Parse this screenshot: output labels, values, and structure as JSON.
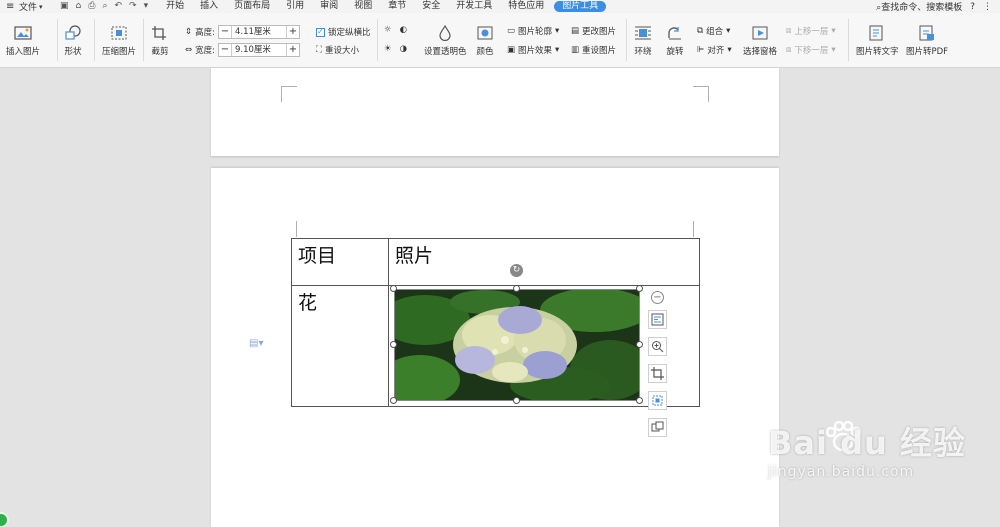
{
  "menubar": {
    "file_label": "文件",
    "tabs": [
      "开始",
      "插入",
      "页面布局",
      "引用",
      "审阅",
      "视图",
      "章节",
      "安全",
      "开发工具",
      "特色应用",
      "图片工具"
    ],
    "active_tab": "图片工具",
    "search_label": "查找命令、搜索模板",
    "help_label": "?"
  },
  "ribbon": {
    "insert_picture": "插入图片",
    "shape": "形状",
    "compress": "压缩图片",
    "crop": "截剪",
    "height_label": "高度:",
    "height_value": "4.11厘米",
    "width_label": "宽度:",
    "width_value": "9.10厘米",
    "lock_ratio": "锁定纵横比",
    "reset_size": "重设大小",
    "set_transparent": "设置透明色",
    "color": "颜色",
    "outline": "图片轮廓",
    "effects": "图片效果",
    "change_picture": "更改图片",
    "reset_picture": "重设图片",
    "wrap": "环绕",
    "rotate": "旋转",
    "group": "组合",
    "align": "对齐",
    "selection_pane": "选择窗格",
    "bring_forward": "上移一层",
    "send_backward": "下移一层",
    "to_text": "图片转文字",
    "to_pdf": "图片转PDF"
  },
  "document": {
    "table": {
      "header": [
        "项目",
        "照片"
      ],
      "row": [
        "花",
        ""
      ]
    }
  },
  "watermark": {
    "brand": "Bai du 经验",
    "url": "jingyan.baidu.com"
  }
}
